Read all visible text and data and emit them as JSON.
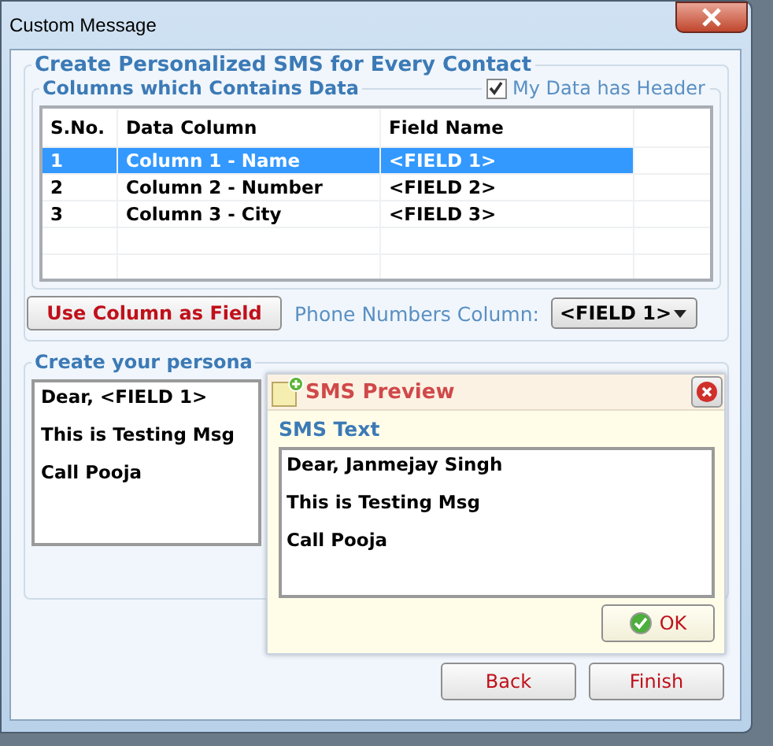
{
  "window": {
    "title": "Custom Message"
  },
  "main_group": {
    "title": "Create Personalized SMS for Every Contact"
  },
  "columns_group": {
    "title": "Columns which Contains Data",
    "header_checkbox": {
      "label": "My Data has Header",
      "checked": true
    }
  },
  "table": {
    "columns": [
      "S.No.",
      "Data Column",
      "Field Name"
    ],
    "rows": [
      {
        "cells": [
          "1",
          "Column 1 - Name",
          "<FIELD 1>"
        ],
        "selected": true
      },
      {
        "cells": [
          "2",
          "Column 2 - Number",
          "<FIELD 2>"
        ],
        "selected": false
      },
      {
        "cells": [
          "3",
          "Column 3 - City",
          "<FIELD 3>"
        ],
        "selected": false
      }
    ]
  },
  "use_column_button": "Use Column as Field",
  "phone_column": {
    "label": "Phone Numbers Column:",
    "value": "<FIELD 1>"
  },
  "message_group": {
    "title": "Create your persona",
    "lines": [
      "Dear, <FIELD 1>",
      "This is Testing Msg",
      "Call Pooja"
    ]
  },
  "preview": {
    "title": "SMS Preview",
    "label": "SMS Text",
    "lines": [
      "Dear, Janmejay Singh",
      "This is Testing Msg",
      "Call Pooja"
    ],
    "ok": "OK"
  },
  "buttons": [
    "Back",
    "Finish"
  ]
}
